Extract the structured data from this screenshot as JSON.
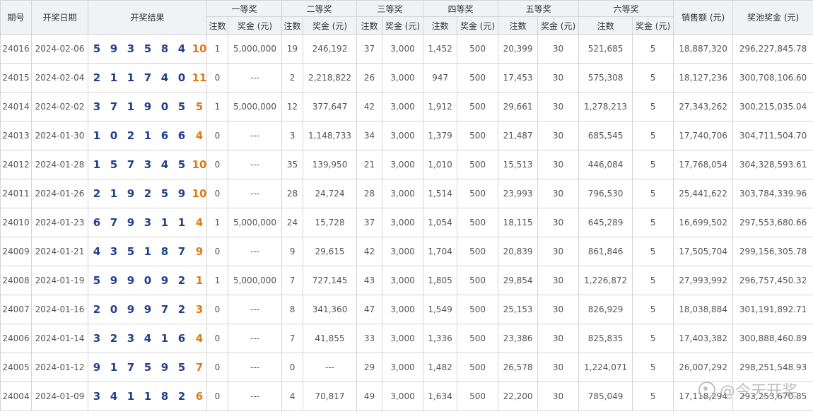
{
  "headers": {
    "period": "期号",
    "date": "开奖日期",
    "result": "开奖结果",
    "prize1": "一等奖",
    "prize2": "二等奖",
    "prize3": "三等奖",
    "prize4": "四等奖",
    "prize5": "五等奖",
    "prize6": "六等奖",
    "sales": "销售额 (元)",
    "pool": "奖池奖金 (元)",
    "count": "注数",
    "amount": "奖金 (元)"
  },
  "colors": {
    "main_ball": "#1f3f8f",
    "special_ball": "#e07a10",
    "header_bg": "#f1f2f6",
    "border": "#d5d5d5"
  },
  "rows": [
    {
      "id": "24016",
      "date": "2024-02-06",
      "balls": [
        "5",
        "9",
        "3",
        "5",
        "8",
        "4"
      ],
      "special": "10",
      "p1c": "1",
      "p1a": "5,000,000",
      "p2c": "19",
      "p2a": "246,192",
      "p3c": "37",
      "p3a": "3,000",
      "p4c": "1,452",
      "p4a": "500",
      "p5c": "20,399",
      "p5a": "30",
      "p6c": "521,685",
      "p6a": "5",
      "sales": "18,887,320",
      "pool": "296,227,845.78"
    },
    {
      "id": "24015",
      "date": "2024-02-04",
      "balls": [
        "2",
        "1",
        "1",
        "7",
        "4",
        "0"
      ],
      "special": "11",
      "p1c": "0",
      "p1a": "---",
      "p2c": "2",
      "p2a": "2,218,822",
      "p3c": "26",
      "p3a": "3,000",
      "p4c": "947",
      "p4a": "500",
      "p5c": "17,453",
      "p5a": "30",
      "p6c": "575,308",
      "p6a": "5",
      "sales": "18,127,236",
      "pool": "300,708,106.60"
    },
    {
      "id": "24014",
      "date": "2024-02-02",
      "balls": [
        "3",
        "7",
        "1",
        "9",
        "0",
        "5"
      ],
      "special": "5",
      "p1c": "1",
      "p1a": "5,000,000",
      "p2c": "12",
      "p2a": "377,647",
      "p3c": "42",
      "p3a": "3,000",
      "p4c": "1,912",
      "p4a": "500",
      "p5c": "29,661",
      "p5a": "30",
      "p6c": "1,278,213",
      "p6a": "5",
      "sales": "27,343,262",
      "pool": "300,215,035.04"
    },
    {
      "id": "24013",
      "date": "2024-01-30",
      "balls": [
        "1",
        "0",
        "2",
        "1",
        "6",
        "6"
      ],
      "special": "4",
      "p1c": "0",
      "p1a": "---",
      "p2c": "3",
      "p2a": "1,148,733",
      "p3c": "34",
      "p3a": "3,000",
      "p4c": "1,379",
      "p4a": "500",
      "p5c": "21,487",
      "p5a": "30",
      "p6c": "685,545",
      "p6a": "5",
      "sales": "17,740,706",
      "pool": "304,711,504.70"
    },
    {
      "id": "24012",
      "date": "2024-01-28",
      "balls": [
        "1",
        "5",
        "7",
        "3",
        "4",
        "5"
      ],
      "special": "10",
      "p1c": "0",
      "p1a": "---",
      "p2c": "35",
      "p2a": "139,950",
      "p3c": "21",
      "p3a": "3,000",
      "p4c": "1,010",
      "p4a": "500",
      "p5c": "15,513",
      "p5a": "30",
      "p6c": "446,084",
      "p6a": "5",
      "sales": "17,768,054",
      "pool": "304,328,593.61"
    },
    {
      "id": "24011",
      "date": "2024-01-26",
      "balls": [
        "2",
        "1",
        "9",
        "2",
        "5",
        "9"
      ],
      "special": "10",
      "p1c": "0",
      "p1a": "---",
      "p2c": "28",
      "p2a": "24,724",
      "p3c": "28",
      "p3a": "3,000",
      "p4c": "1,514",
      "p4a": "500",
      "p5c": "23,993",
      "p5a": "30",
      "p6c": "796,530",
      "p6a": "5",
      "sales": "25,441,622",
      "pool": "303,784,339.96"
    },
    {
      "id": "24010",
      "date": "2024-01-23",
      "balls": [
        "6",
        "7",
        "9",
        "3",
        "1",
        "1"
      ],
      "special": "4",
      "p1c": "1",
      "p1a": "5,000,000",
      "p2c": "24",
      "p2a": "15,728",
      "p3c": "37",
      "p3a": "3,000",
      "p4c": "1,054",
      "p4a": "500",
      "p5c": "18,115",
      "p5a": "30",
      "p6c": "645,289",
      "p6a": "5",
      "sales": "16,699,502",
      "pool": "297,553,680.66"
    },
    {
      "id": "24009",
      "date": "2024-01-21",
      "balls": [
        "4",
        "3",
        "5",
        "1",
        "8",
        "7"
      ],
      "special": "9",
      "p1c": "0",
      "p1a": "---",
      "p2c": "9",
      "p2a": "29,615",
      "p3c": "42",
      "p3a": "3,000",
      "p4c": "1,704",
      "p4a": "500",
      "p5c": "20,839",
      "p5a": "30",
      "p6c": "861,846",
      "p6a": "5",
      "sales": "17,505,704",
      "pool": "299,156,305.78"
    },
    {
      "id": "24008",
      "date": "2024-01-19",
      "balls": [
        "5",
        "9",
        "9",
        "0",
        "9",
        "2"
      ],
      "special": "1",
      "p1c": "1",
      "p1a": "5,000,000",
      "p2c": "7",
      "p2a": "727,145",
      "p3c": "43",
      "p3a": "3,000",
      "p4c": "1,805",
      "p4a": "500",
      "p5c": "29,854",
      "p5a": "30",
      "p6c": "1,226,872",
      "p6a": "5",
      "sales": "27,993,992",
      "pool": "296,757,450.32"
    },
    {
      "id": "24007",
      "date": "2024-01-16",
      "balls": [
        "2",
        "0",
        "9",
        "9",
        "7",
        "2"
      ],
      "special": "3",
      "p1c": "0",
      "p1a": "---",
      "p2c": "8",
      "p2a": "341,360",
      "p3c": "47",
      "p3a": "3,000",
      "p4c": "1,549",
      "p4a": "500",
      "p5c": "25,153",
      "p5a": "30",
      "p6c": "826,929",
      "p6a": "5",
      "sales": "18,038,884",
      "pool": "301,191,892.71"
    },
    {
      "id": "24006",
      "date": "2024-01-14",
      "balls": [
        "3",
        "2",
        "3",
        "4",
        "1",
        "6"
      ],
      "special": "4",
      "p1c": "0",
      "p1a": "---",
      "p2c": "7",
      "p2a": "41,855",
      "p3c": "33",
      "p3a": "3,000",
      "p4c": "1,336",
      "p4a": "500",
      "p5c": "23,386",
      "p5a": "30",
      "p6c": "825,835",
      "p6a": "5",
      "sales": "17,403,382",
      "pool": "300,888,460.89"
    },
    {
      "id": "24005",
      "date": "2024-01-12",
      "balls": [
        "9",
        "1",
        "7",
        "5",
        "9",
        "5"
      ],
      "special": "7",
      "p1c": "0",
      "p1a": "---",
      "p2c": "0",
      "p2a": "---",
      "p3c": "29",
      "p3a": "3,000",
      "p4c": "1,482",
      "p4a": "500",
      "p5c": "26,578",
      "p5a": "30",
      "p6c": "1,224,071",
      "p6a": "5",
      "sales": "26,007,292",
      "pool": "298,251,548.93"
    },
    {
      "id": "24004",
      "date": "2024-01-09",
      "balls": [
        "3",
        "4",
        "1",
        "1",
        "8",
        "2"
      ],
      "special": "6",
      "p1c": "0",
      "p1a": "---",
      "p2c": "4",
      "p2a": "70,817",
      "p3c": "49",
      "p3a": "3,000",
      "p4c": "1,634",
      "p4a": "500",
      "p5c": "22,200",
      "p5a": "30",
      "p6c": "785,049",
      "p6a": "5",
      "sales": "17,118,294",
      "pool": "293,253,670.85"
    }
  ],
  "watermark": "@今天开奖"
}
